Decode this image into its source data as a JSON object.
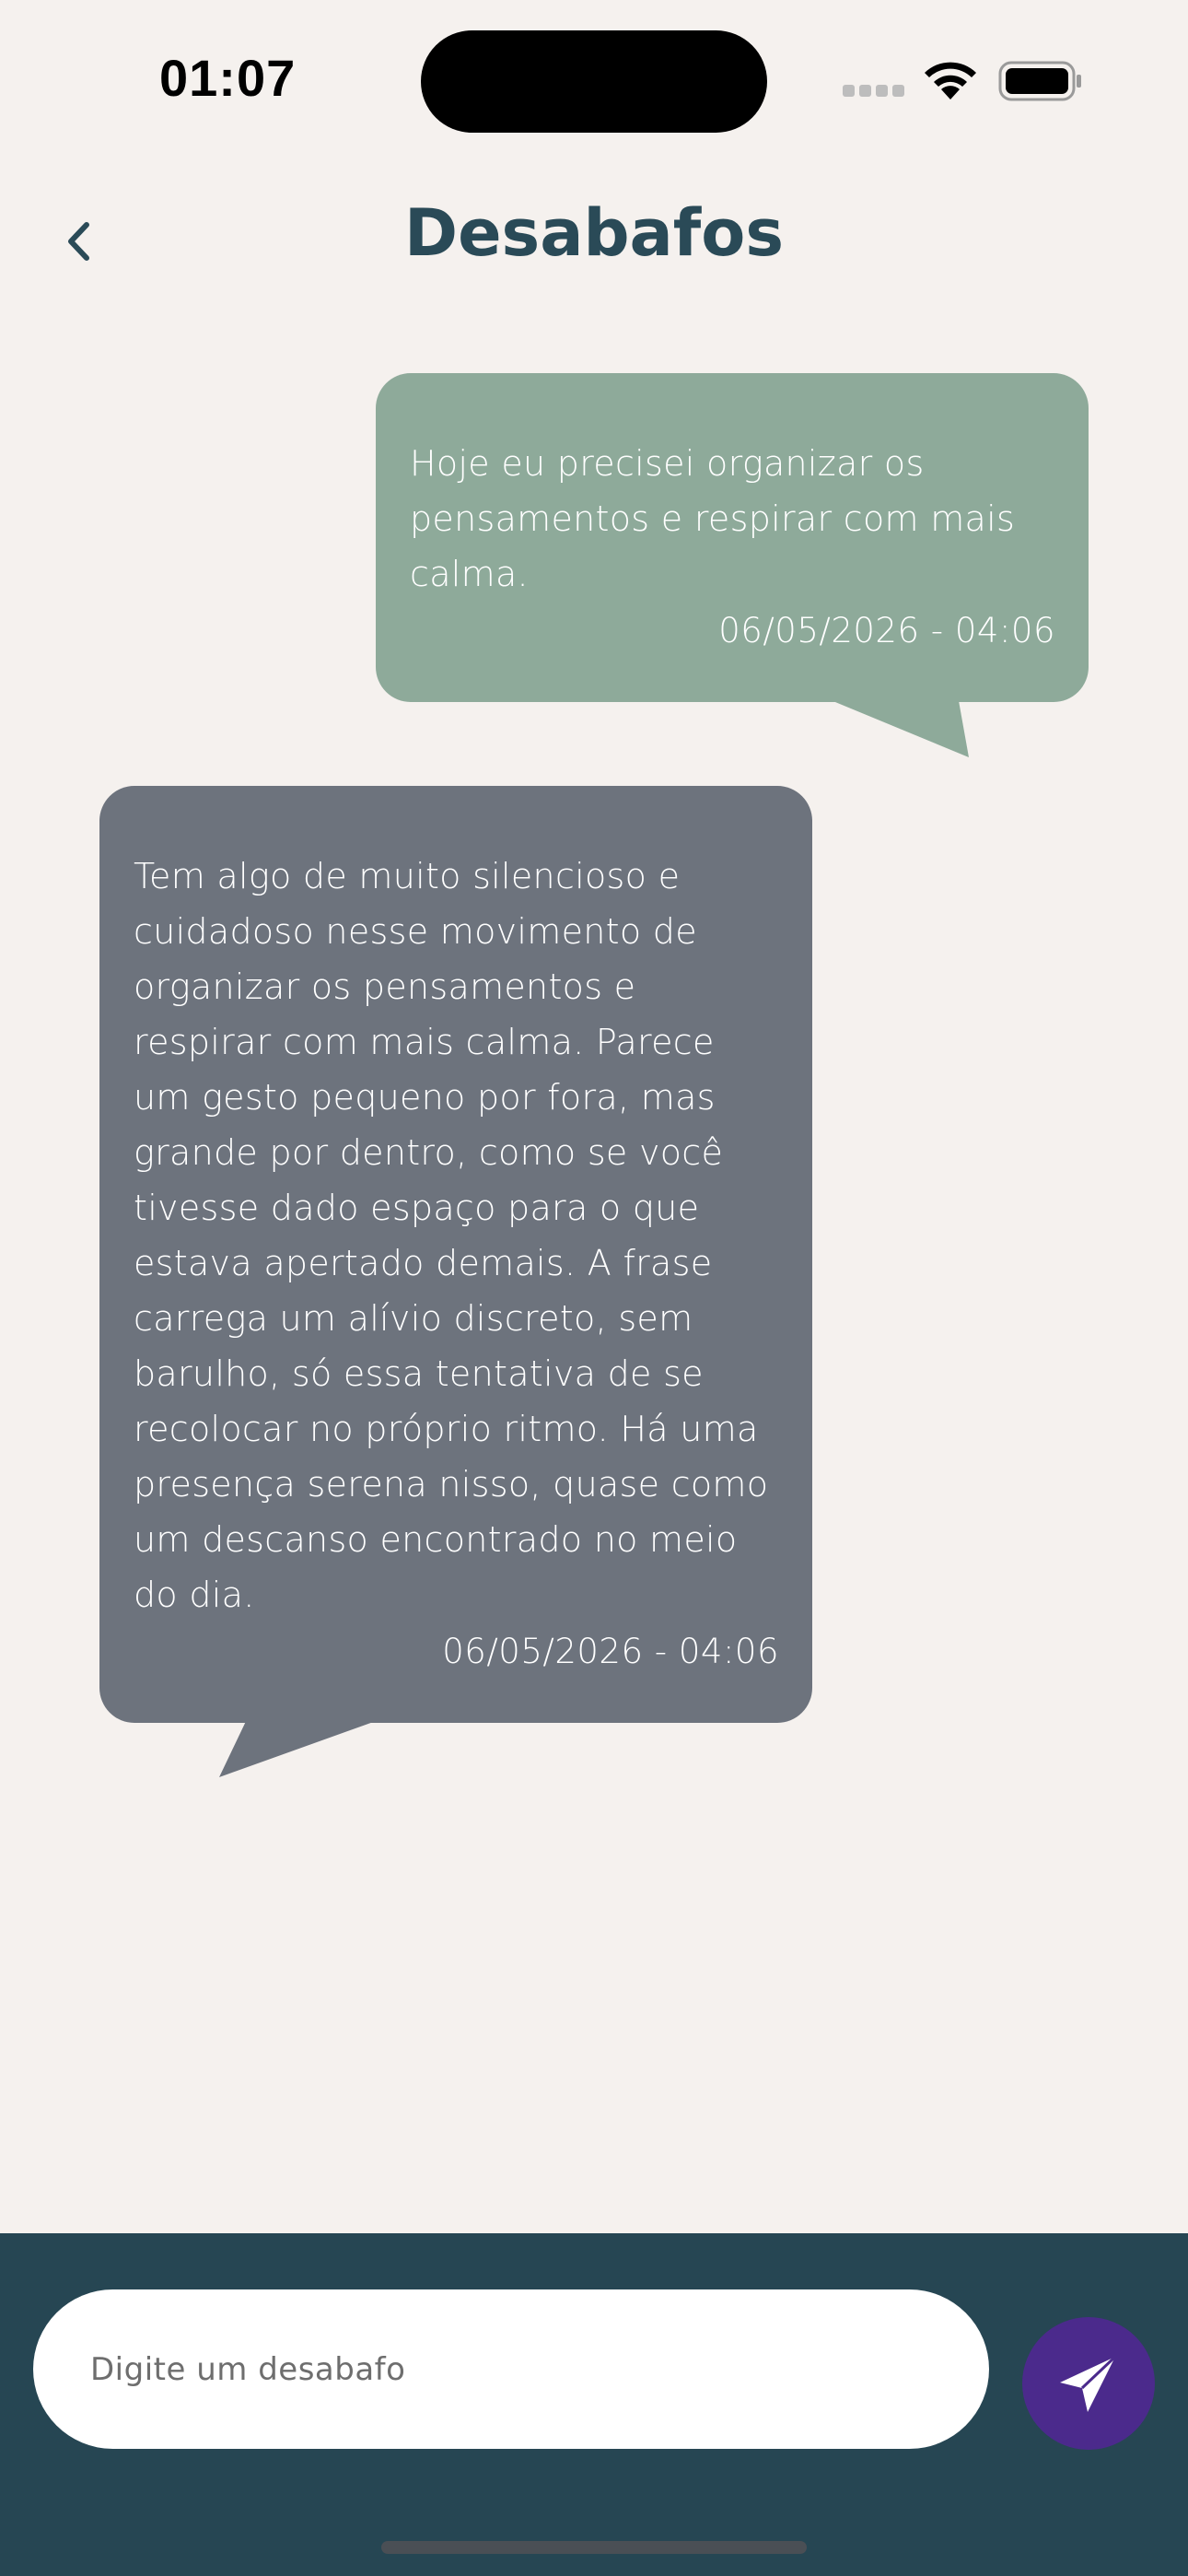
{
  "status_bar": {
    "time": "01:07"
  },
  "header": {
    "title": "Desabafos"
  },
  "messages": [
    {
      "role": "user",
      "text": "Hoje eu precisei organizar os pensamentos e respirar com mais calma.",
      "timestamp": "06/05/2026 - 04:06",
      "color": "#8eaa9a"
    },
    {
      "role": "reply",
      "text": "Tem algo de muito silencioso e cuidadoso nesse movimento de organizar os pensamentos e respirar com mais calma. Parece um gesto pequeno por fora, mas grande por dentro, como se você tivesse dado espaço para o que estava apertado demais. A frase carrega um alívio discreto, sem barulho, só essa tentativa de se recolocar no próprio ritmo. Há uma presença serena nisso, quase como um descanso encontrado no meio do dia.",
      "timestamp": "06/05/2026 - 04:06",
      "color": "#6d737d"
    }
  ],
  "composer": {
    "placeholder": "Digite um desabafo",
    "value": "",
    "send_icon": "send-icon",
    "bar_color": "#264653",
    "send_color": "#4b2a8c"
  },
  "colors": {
    "background": "#f5f1ee",
    "title": "#2a4a57"
  }
}
